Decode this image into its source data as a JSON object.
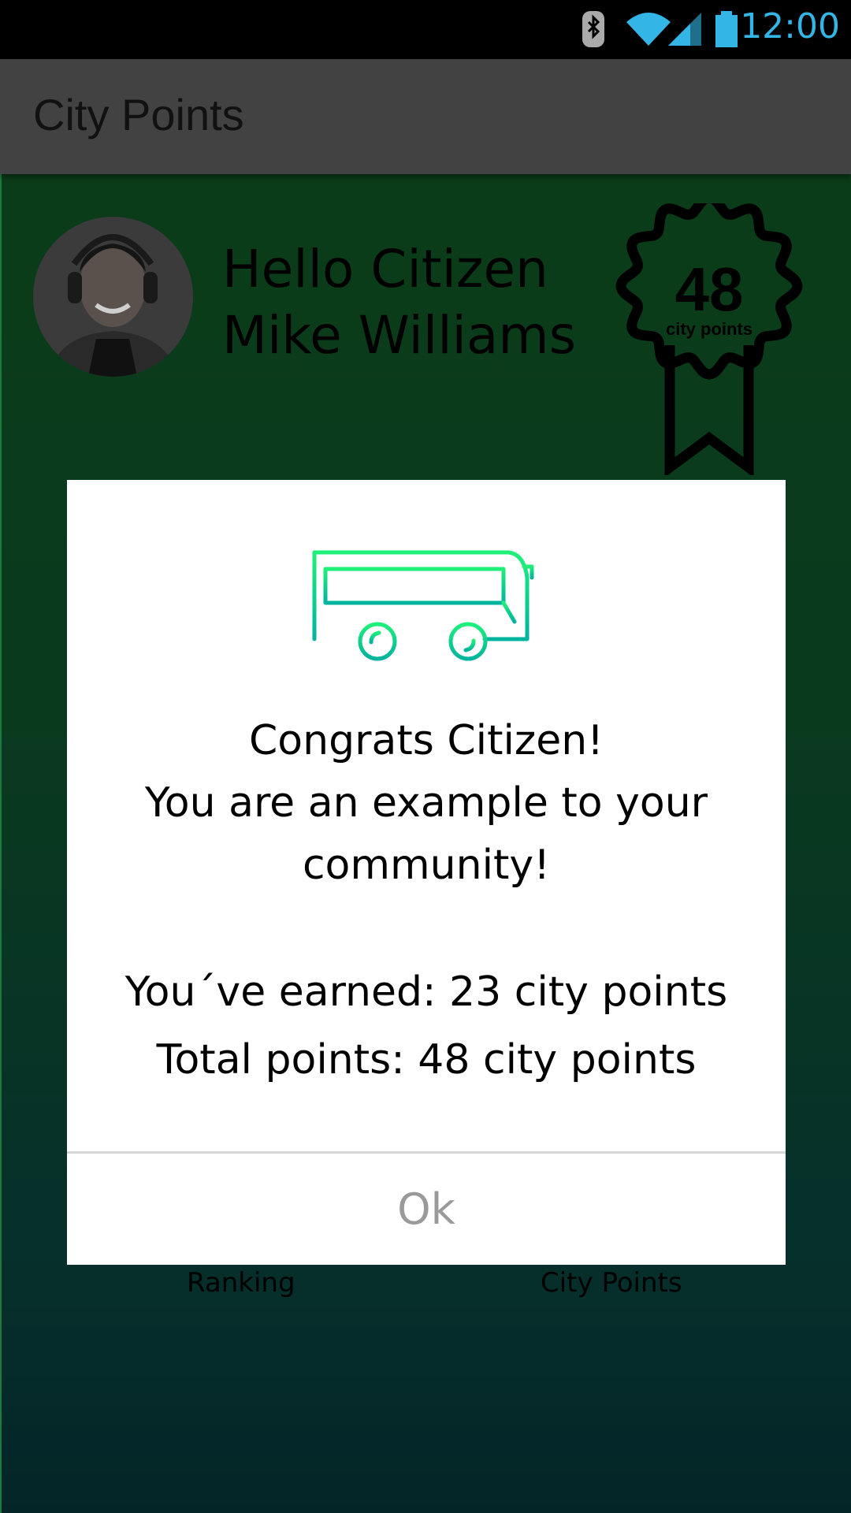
{
  "status_bar": {
    "time": "12:00",
    "icons": [
      "bluetooth-icon",
      "wifi-icon",
      "cell-signal-icon",
      "battery-icon"
    ],
    "icon_color": "#33b5e5"
  },
  "app_bar": {
    "title": "City Points"
  },
  "profile": {
    "greeting_line1": "Hello Citizen",
    "greeting_line2": "Mike Williams"
  },
  "badge": {
    "points": "48",
    "label": "city points"
  },
  "bottom_nav": {
    "left_label": "Ranking",
    "right_label": "City Points"
  },
  "dialog": {
    "icon": "bus-icon",
    "line1": "Congrats Citizen!",
    "line2": "You are an example to your",
    "line3": "community!",
    "earned": "You´ve earned: 23 city points",
    "total": "Total points: 48 city points",
    "ok_label": "Ok"
  },
  "colors": {
    "appbar": "#424242",
    "background_top": "#0b3c19",
    "background_bottom": "#042528",
    "accent_green": "#1de87a",
    "accent_teal": "#00b89c"
  }
}
